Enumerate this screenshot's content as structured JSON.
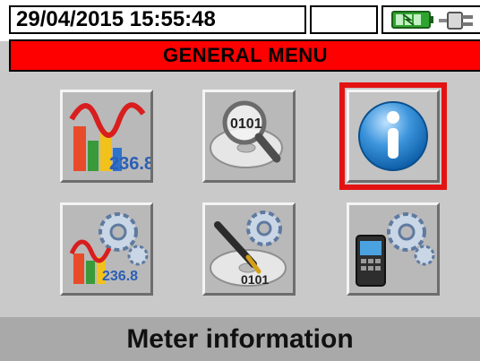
{
  "status_bar": {
    "datetime": "29/04/2015 15:55:48",
    "icons": [
      "battery-charging-icon",
      "power-plug-icon"
    ],
    "battery_color": "#2fa52f"
  },
  "title": "GENERAL MENU",
  "menu": [
    {
      "name": "real-time-values",
      "icon": "waveform-bars-chart-icon",
      "label": "236.8",
      "selected": false
    },
    {
      "name": "recording-analysis",
      "icon": "magnifier-disc-icon",
      "label": "0101",
      "selected": false
    },
    {
      "name": "meter-information",
      "icon": "info-icon",
      "label": "i",
      "selected": true
    },
    {
      "name": "analyzer-settings",
      "icon": "chart-gears-icon",
      "label": "236.8",
      "selected": false
    },
    {
      "name": "recording-settings",
      "icon": "pen-disc-gears-icon",
      "label": "0101",
      "selected": false
    },
    {
      "name": "general-settings",
      "icon": "meter-gears-icon",
      "label": "",
      "selected": false
    }
  ],
  "caption": "Meter information",
  "colors": {
    "title_bar": "#ff0000",
    "selection": "#e31313",
    "background": "#c9c9c9"
  }
}
